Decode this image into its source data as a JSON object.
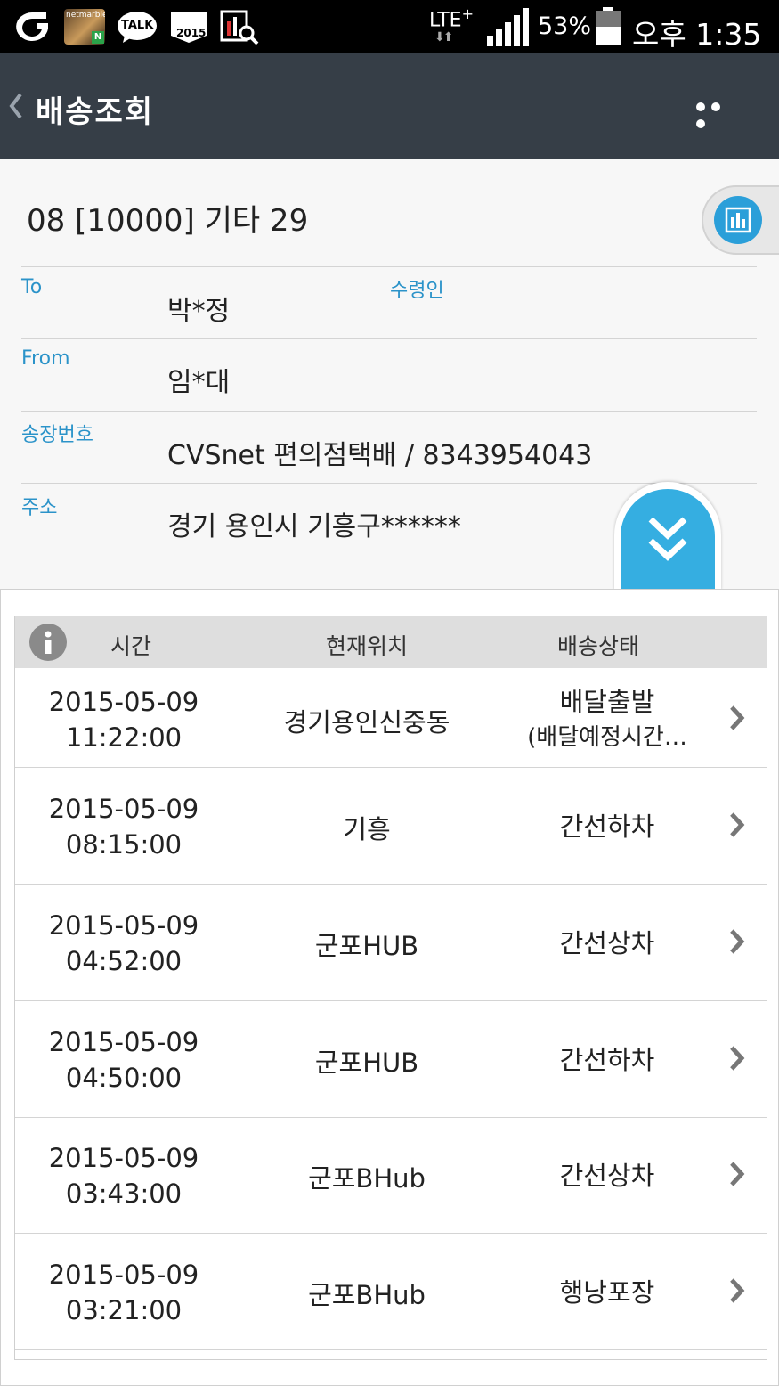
{
  "status_bar": {
    "network": "LTE",
    "network_plus": "+",
    "battery_text": "53%",
    "time": "오후 1:35",
    "app_icons": [
      "olleh-icon",
      "netmarble-icon",
      "kakaotalk-icon",
      "2015-app-icon",
      "search-chart-icon"
    ],
    "netmarble_label": "netmarble",
    "netmarble_badge": "N",
    "talk_label": "TALK",
    "app2015_label": "2015"
  },
  "header": {
    "title": "배송조회"
  },
  "summary": {
    "item_title": "08 [10000] 기타 29",
    "fields": [
      {
        "label": "To",
        "value": "박*정",
        "extra_label": "수령인"
      },
      {
        "label": "From",
        "value": "임*대"
      },
      {
        "label": "송장번호",
        "value": "CVSnet 편의점택배 / 8343954043"
      },
      {
        "label": "주소",
        "value": "경기 용인시 기흥구******"
      }
    ]
  },
  "table": {
    "headers": {
      "time": "시간",
      "location": "현재위치",
      "status": "배송상태"
    },
    "rows": [
      {
        "date": "2015-05-09",
        "time": "11:22:00",
        "location": "경기용인신중동",
        "status_line1": "배달출발",
        "status_line2": "(배달예정시간…"
      },
      {
        "date": "2015-05-09",
        "time": "08:15:00",
        "location": "기흥",
        "status_line1": "간선하차",
        "status_line2": ""
      },
      {
        "date": "2015-05-09",
        "time": "04:52:00",
        "location": "군포HUB",
        "status_line1": "간선상차",
        "status_line2": ""
      },
      {
        "date": "2015-05-09",
        "time": "04:50:00",
        "location": "군포HUB",
        "status_line1": "간선하차",
        "status_line2": ""
      },
      {
        "date": "2015-05-09",
        "time": "03:43:00",
        "location": "군포BHub",
        "status_line1": "간선상차",
        "status_line2": ""
      },
      {
        "date": "2015-05-09",
        "time": "03:21:00",
        "location": "군포BHub",
        "status_line1": "행낭포장",
        "status_line2": ""
      }
    ]
  },
  "colors": {
    "header_bg": "#363e47",
    "accent_blue": "#2b93c9",
    "button_blue": "#35aee1"
  }
}
